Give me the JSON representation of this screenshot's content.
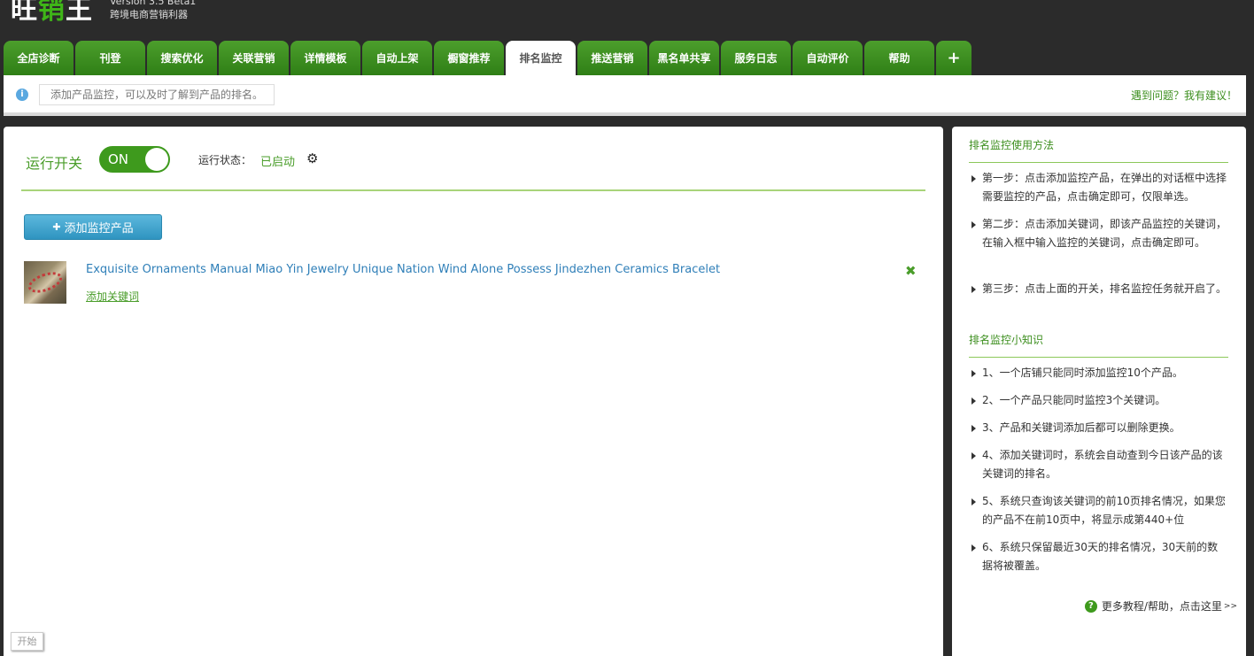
{
  "header": {
    "logo_white": "旺",
    "logo_green": "销",
    "logo_white2": "王",
    "version": "Version 3.5 Beta1",
    "tagline": "跨境电商营销利器"
  },
  "tabs": [
    {
      "label": "全店诊断"
    },
    {
      "label": "刊登"
    },
    {
      "label": "搜索优化"
    },
    {
      "label": "关联营销"
    },
    {
      "label": "详情模板"
    },
    {
      "label": "自动上架"
    },
    {
      "label": "橱窗推荐"
    },
    {
      "label": "排名监控",
      "active": true
    },
    {
      "label": "推送营销"
    },
    {
      "label": "黑名单共享"
    },
    {
      "label": "服务日志"
    },
    {
      "label": "自动评价"
    },
    {
      "label": "帮助"
    }
  ],
  "add_tab_label": "+",
  "infobar": {
    "icon": "info-icon",
    "icon_glyph": "i",
    "placeholder": "添加产品监控，可以及时了解到产品的排名。",
    "feedback": "遇到问题？我有建议！"
  },
  "main": {
    "run_label": "运行开关",
    "toggle_label": "ON",
    "status_label": "运行状态：",
    "status_value": "已启动",
    "add_button": "添加监控产品",
    "add_button_glyph": "✚",
    "product": {
      "title": "Exquisite Ornaments Manual Miao Yin Jewelry Unique Nation Wind Alone Possess Jindezhen Ceramics Bracelet",
      "add_keyword": "添加关键词",
      "delete_glyph": "✖"
    }
  },
  "side": {
    "usage_title": "排名监控使用方法",
    "steps": [
      "第一步：点击添加监控产品，在弹出的对话框中选择需要监控的产品，点击确定即可，仅限单选。",
      "第二步：点击添加关键词，即该产品监控的关键词，在输入框中输入监控的关键词，点击确定即可。",
      "第三步：点击上面的开关，排名监控任务就开启了。"
    ],
    "tips_title": "排名监控小知识",
    "tips": [
      "1、一个店铺只能同时添加监控10个产品。",
      "2、一个产品只能同时监控3个关键词。",
      "3、产品和关键词添加后都可以删除更换。",
      "4、添加关键词时，系统会自动查到今日该产品的该关键词的排名。",
      "5、系统只查询该关键词的前10页排名情况，如果您的产品不在前10页中，将显示成第440+位",
      "6、系统只保留最近30天的排名情况，30天前的数据将被覆盖。"
    ],
    "more_glyph": "?",
    "more_link": "更多教程/帮助，点击这里",
    "more_arrow": ">>"
  },
  "start_button": "开始"
}
